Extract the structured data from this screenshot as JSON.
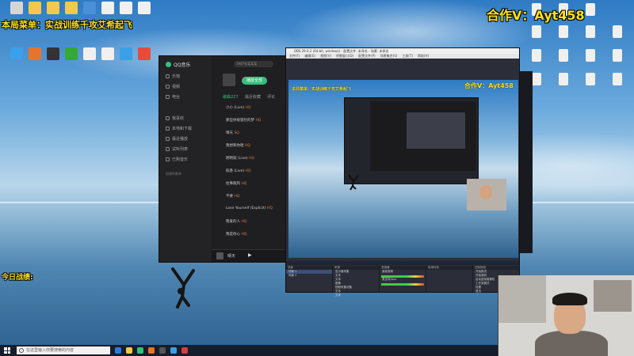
{
  "overlay": {
    "menu_title": "本局菜单：实战训练千攻艾希起飞",
    "cooperation": "合作V：Ayt458",
    "today_record": "今日战绩:"
  },
  "desktop": {
    "left_icons": [
      {
        "label": "",
        "color": "#d6d6d6"
      },
      {
        "label": "",
        "color": "#f2c94c"
      },
      {
        "label": "",
        "color": "#f2c94c"
      },
      {
        "label": "",
        "color": "#f2c94c"
      },
      {
        "label": "",
        "color": "#4a90d9"
      },
      {
        "label": "",
        "color": "#f0f0f0"
      },
      {
        "label": "",
        "color": "#f0f0f0"
      },
      {
        "label": "",
        "color": "#f0f0f0"
      },
      {
        "label": "",
        "color": "#3aa0e8"
      },
      {
        "label": "",
        "color": "#e8742b"
      },
      {
        "label": "",
        "color": "#333333"
      },
      {
        "label": "",
        "color": "#33aa33"
      },
      {
        "label": "",
        "color": "#f0f0f0"
      },
      {
        "label": "",
        "color": "#f0f0f0"
      },
      {
        "label": "",
        "color": "#3aa0e8"
      },
      {
        "label": "",
        "color": "#e84b3c"
      }
    ],
    "right_icon_color": "#f0f0f0"
  },
  "qq_music": {
    "app_name": "QQ音乐",
    "search_placeholder": "1987年某某某",
    "play_all": "播放全部",
    "tabs": [
      "歌曲227",
      "最近收藏",
      "评论"
    ],
    "nav": [
      "乐馆",
      "视频",
      "电台",
      "我喜欢",
      "本地和下载",
      "最近播放",
      "试听列表",
      "已购音乐"
    ],
    "playlists_header": "创建的歌单",
    "songs": [
      {
        "title": "小小 (Live)",
        "hq": "HQ"
      },
      {
        "title": "那些你很冒险的梦",
        "hq": "HQ"
      },
      {
        "title": "晴天",
        "hq": "SQ"
      },
      {
        "title": "我想和你唱",
        "hq": "HQ"
      },
      {
        "title": "明明就 (Live)",
        "hq": "HQ"
      },
      {
        "title": "稻香 (Live)",
        "hq": "HQ"
      },
      {
        "title": "往事随风",
        "hq": "HQ"
      },
      {
        "title": "不要",
        "hq": "HQ"
      },
      {
        "title": "Lose Yourself (Explicit)",
        "hq": "HQ"
      },
      {
        "title": "我爱的人",
        "hq": "HQ"
      },
      {
        "title": "我是你心",
        "hq": "HQ"
      }
    ],
    "now_playing": "晴天"
  },
  "obs": {
    "title": "OBS 29.0.2 (64-bit, windows) - 配置文件: 未命名 - 场景: 未命名",
    "menu": [
      "文件(F)",
      "编辑(E)",
      "视图(V)",
      "停靠窗口(D)",
      "配置文件(P)",
      "场景集合(S)",
      "工具(T)",
      "帮助(H)"
    ],
    "docks": [
      "场景",
      "来源",
      "混音器",
      "转场特效",
      "控制按钮"
    ],
    "scenes": [
      "场景 1",
      "场景 2"
    ],
    "sources": [
      "显示器采集",
      "文本",
      "文本",
      "图像",
      "视频采集设备",
      "文本",
      "文本"
    ],
    "mixer": [
      "桌面音频",
      "麦克风/Aux"
    ],
    "controls": [
      "开始推流",
      "开始录制",
      "启动虚拟摄像机",
      "工作室模式",
      "设置",
      "退出"
    ]
  },
  "taskbar": {
    "search_placeholder": "在这里输入你要搜索的内容",
    "apps": [
      "#2d7be0",
      "#f2c94c",
      "#31c27c",
      "#e8742b",
      "#555555",
      "#3aa0e8",
      "#d04040"
    ]
  }
}
